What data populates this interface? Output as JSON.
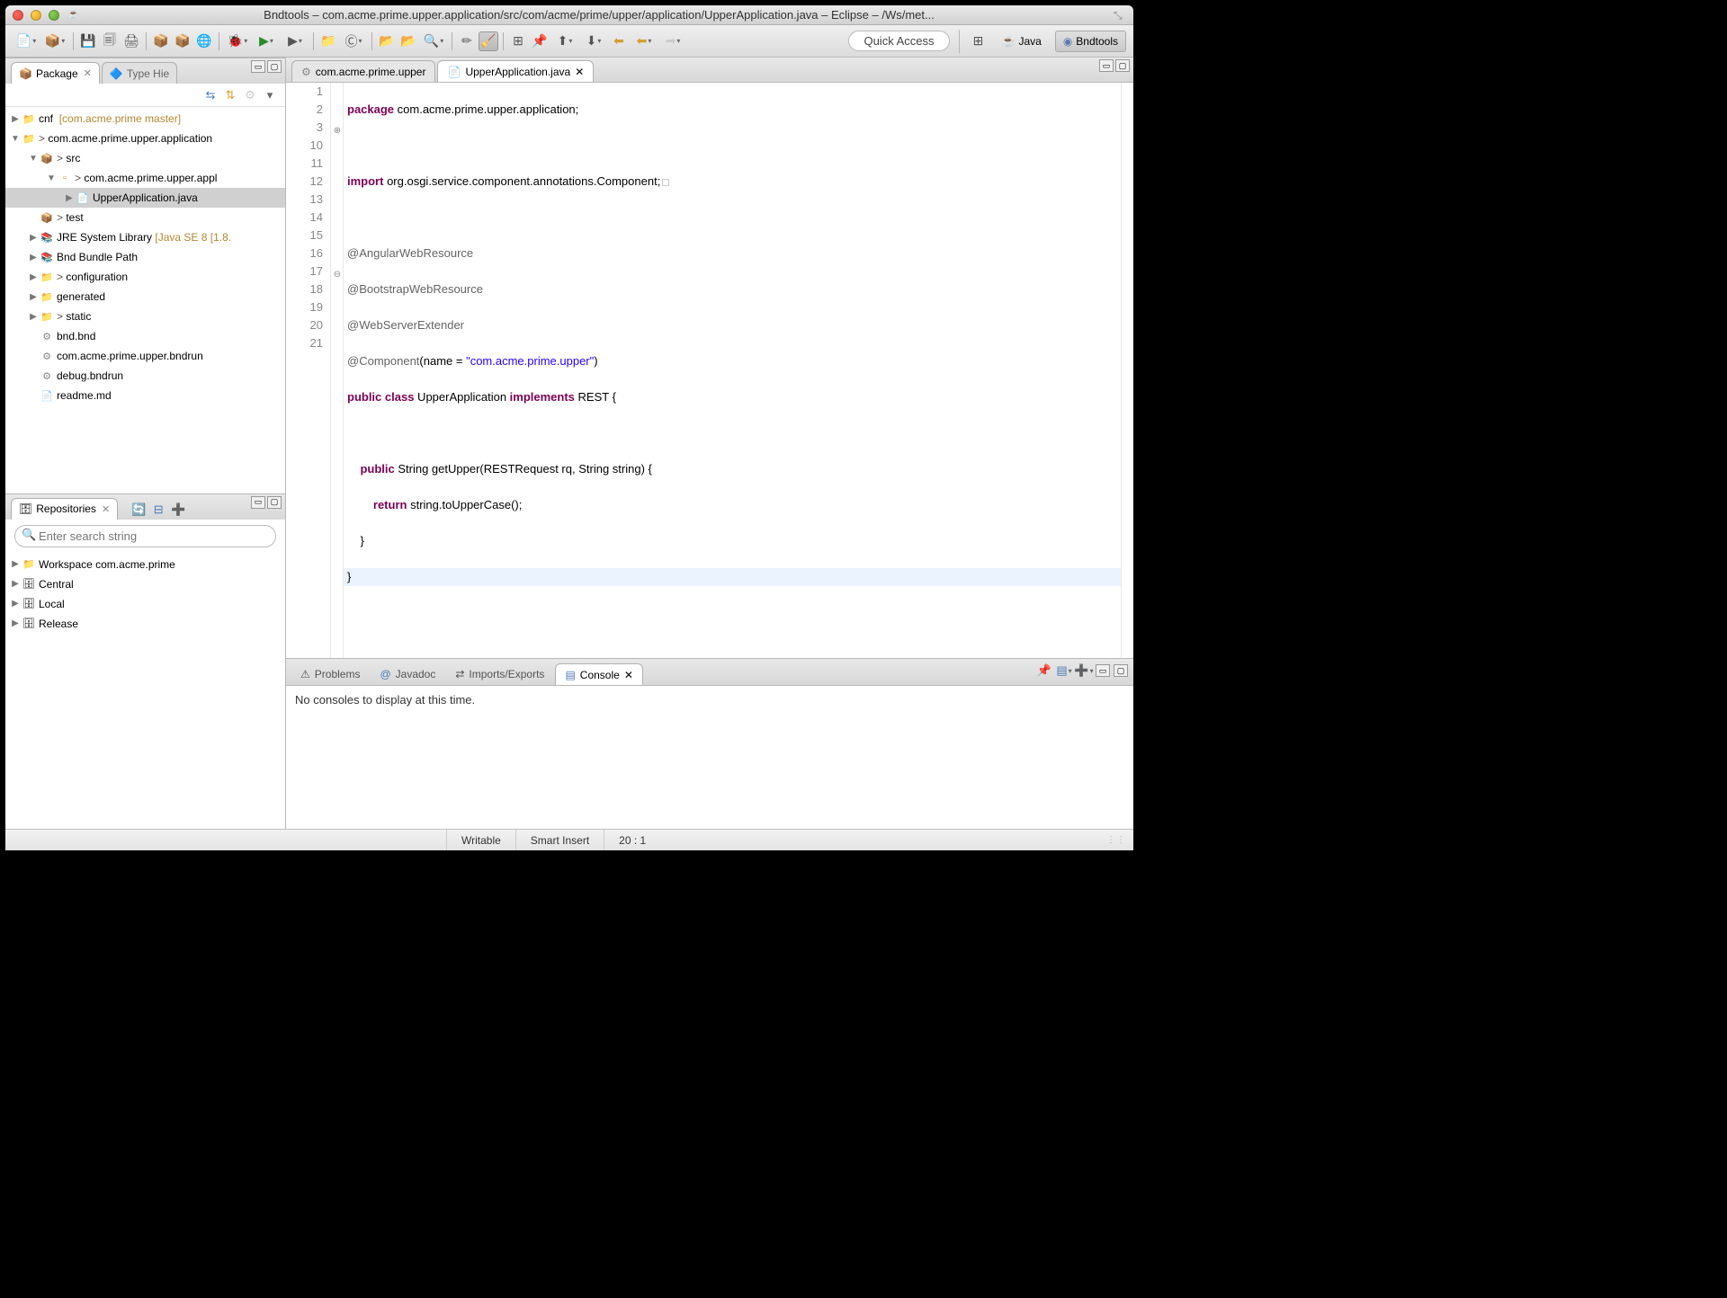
{
  "window": {
    "title": "Bndtools – com.acme.prime.upper.application/src/com/acme/prime/upper/application/UpperApplication.java – Eclipse – /Ws/met..."
  },
  "quick_access": {
    "label": "Quick Access"
  },
  "perspectives": {
    "java": "Java",
    "bndtools": "Bndtools"
  },
  "package_view": {
    "tab_label": "Package",
    "type_hier_label": "Type Hie",
    "tree": {
      "cnf_label": "cnf",
      "cnf_decor": "[com.acme.prime master]",
      "project_label": "com.acme.prime.upper.application",
      "src_label": "src",
      "pkg_label": "com.acme.prime.upper.appl",
      "file_label": "UpperApplication.java",
      "test_label": "test",
      "jre_label": "JRE System Library",
      "jre_decor": "[Java SE 8 [1.8.",
      "bnd_path_label": "Bnd Bundle Path",
      "config_label": "configuration",
      "generated_label": "generated",
      "static_label": "static",
      "bnd_bnd": "bnd.bnd",
      "bndrun": "com.acme.prime.upper.bndrun",
      "debug_bndrun": "debug.bndrun",
      "readme": "readme.md"
    }
  },
  "repo_view": {
    "tab_label": "Repositories",
    "search_placeholder": "Enter search string",
    "items": {
      "workspace": "Workspace com.acme.prime",
      "central": "Central",
      "local": "Local",
      "release": "Release"
    }
  },
  "editor": {
    "tab1": "com.acme.prime.upper",
    "tab2": "UpperApplication.java",
    "lines": {
      "l1": "1",
      "l2": "2",
      "l3": "3",
      "l10": "10",
      "l11": "11",
      "l12": "12",
      "l13": "13",
      "l14": "14",
      "l15": "15",
      "l16": "16",
      "l17": "17",
      "l18": "18",
      "l19": "19",
      "l20": "20",
      "l21": "21"
    },
    "code": {
      "pkg_kw": "package",
      "pkg_name": " com.acme.prime.upper.application;",
      "imp_kw": "import",
      "imp_name": " org.osgi.service.component.annotations.Component;",
      "ann1": "@AngularWebResource",
      "ann2": "@BootstrapWebResource",
      "ann3": "@WebServerExtender",
      "ann4a": "@Component",
      "ann4b": "(name = ",
      "ann4c": "\"com.acme.prime.upper\"",
      "ann4d": ")",
      "cls_public": "public",
      "cls_class": " class",
      "cls_name": " UpperApplication ",
      "cls_impl": "implements",
      "cls_rest": " REST {",
      "m_public": "    public",
      "m_sig": " String getUpper(RESTRequest rq, String string) {",
      "m_ret": "        return",
      "m_body": " string.toUpperCase();",
      "m_close": "    }",
      "c_close": "}"
    }
  },
  "bottom": {
    "problems": "Problems",
    "javadoc": "Javadoc",
    "imports": "Imports/Exports",
    "console": "Console",
    "message": "No consoles to display at this time."
  },
  "status": {
    "writable": "Writable",
    "insert": "Smart Insert",
    "pos": "20 : 1"
  }
}
